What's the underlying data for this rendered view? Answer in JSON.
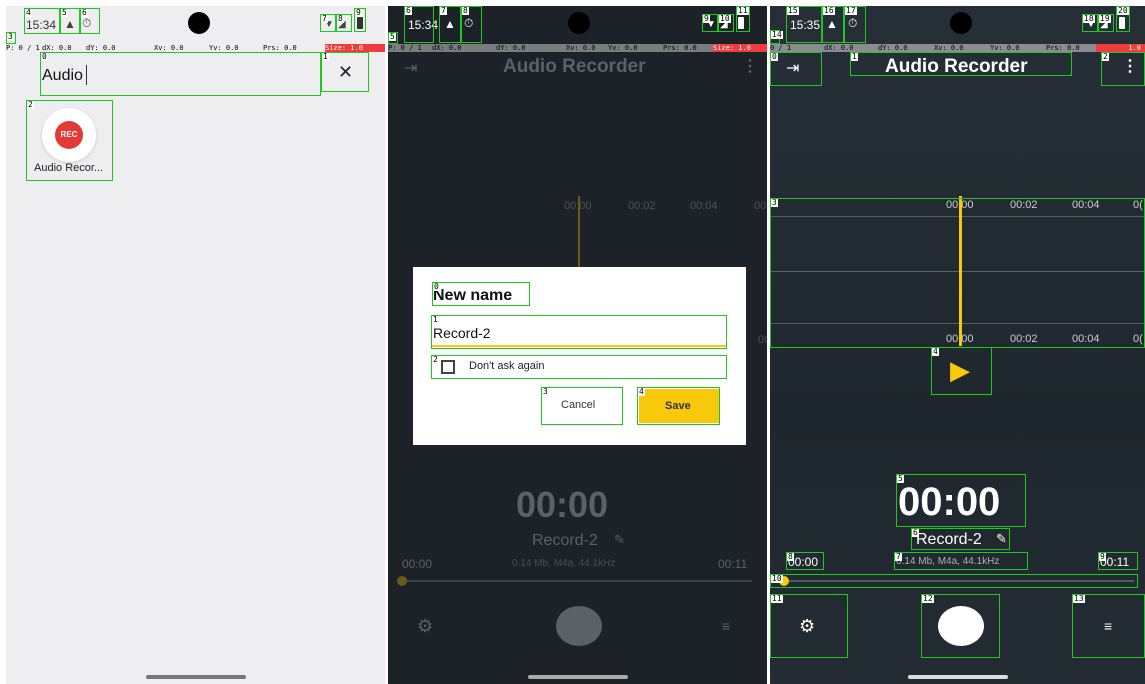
{
  "panel1": {
    "time": "15:34",
    "debug": [
      "P: 0 / 1",
      "dX: 0.0",
      "dY: 0.0",
      "Xv: 0.0",
      "Yv: 0.0",
      "Prs: 0.0",
      "Size: 1.0"
    ],
    "search_value": "Audio",
    "app_icon_badge": "REC",
    "app_label": "Audio Recor...",
    "marks": [
      "0",
      "1",
      "2",
      "3",
      "4",
      "5",
      "6",
      "7",
      "8",
      "9"
    ]
  },
  "panel2": {
    "time": "15:34",
    "debug": [
      "P: 0 / 1",
      "dX: 0.0",
      "dY: 0.0",
      "Xv: 0.0",
      "Yv: 0.0",
      "Prs: 0.0",
      "Size: 1.0"
    ],
    "app_title": "Audio Recorder",
    "ticks": [
      "00:00",
      "00:02",
      "00:04",
      "00"
    ],
    "dialog": {
      "title": "New name",
      "input_value": "Record-2",
      "checkbox_label": "Don't ask again",
      "cancel_label": "Cancel",
      "save_label": "Save"
    },
    "timer": "00:00",
    "record_name": "Record-2",
    "file_info": "0.14 Mb, M4a, 44.1kHz",
    "time_start": "00:00",
    "time_end": "00:11",
    "marks": [
      "0",
      "1",
      "2",
      "3",
      "4",
      "5",
      "6",
      "7",
      "8",
      "9",
      "10",
      "11"
    ]
  },
  "panel3": {
    "time": "15:35",
    "debug": [
      "0 / 1",
      "dX: 0.0",
      "dY: 0.0",
      "Xv: 0.0",
      "Yv: 0.0",
      "Prs: 0.0",
      "1.0"
    ],
    "app_title": "Audio Recorder",
    "ticks_top": [
      "00:00",
      "00:02",
      "00:04",
      "0("
    ],
    "ticks_bottom": [
      "00:00",
      "00:02",
      "00:04",
      "0("
    ],
    "timer": "00:00",
    "record_name": "Record-2",
    "file_info": "0.14 Mb, M4a, 44.1kHz",
    "time_start": "00:00",
    "time_end": "00:11",
    "marks": [
      "0",
      "1",
      "2",
      "3",
      "4",
      "5",
      "6",
      "7",
      "8",
      "9",
      "10",
      "11",
      "12",
      "13",
      "14",
      "15",
      "16",
      "17",
      "18",
      "19",
      "20"
    ]
  },
  "colors": {
    "accent_yellow": "#f7c90a",
    "rec_red": "#e53935",
    "debug_red": "#f03c3c",
    "bounding_green": "#1ec81e"
  }
}
